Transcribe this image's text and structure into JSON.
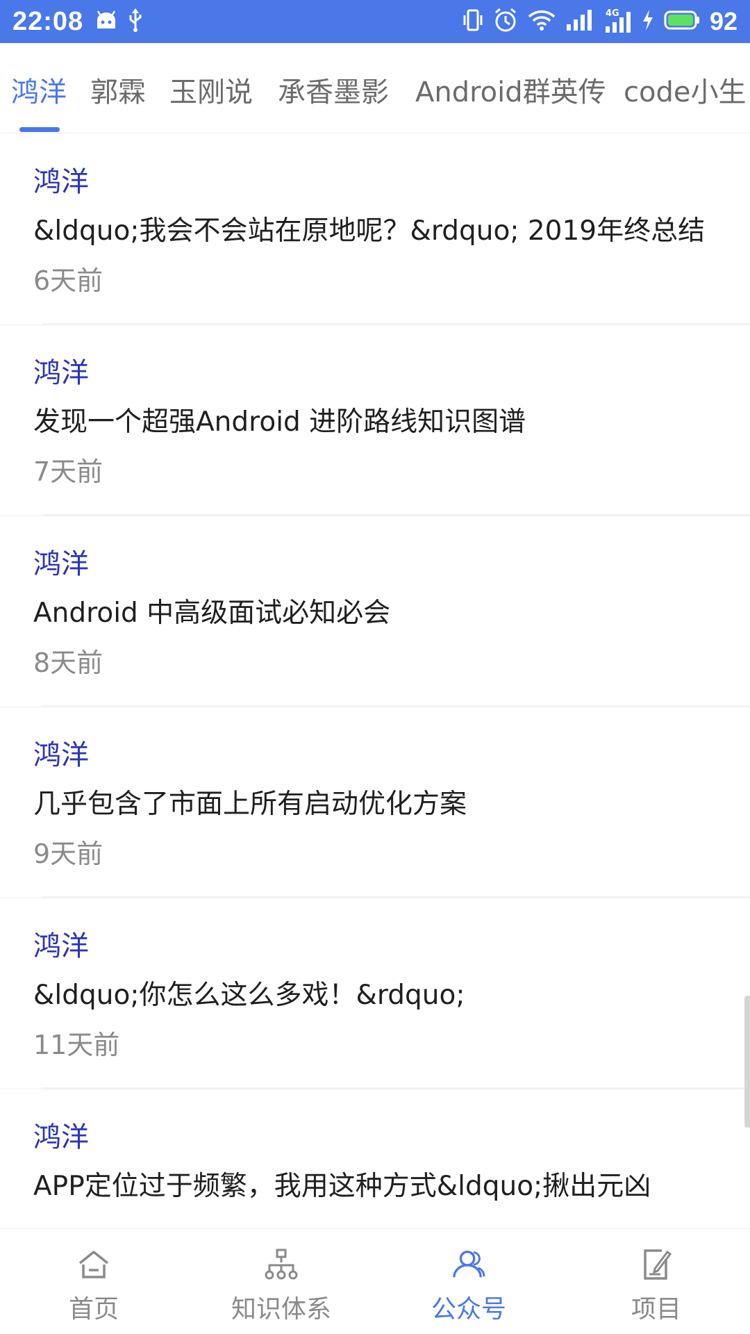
{
  "status_bar": {
    "time": "22:08",
    "network": "4G",
    "battery": "92",
    "colors": {
      "background": "#4a78e8",
      "foreground": "#ffffff"
    }
  },
  "tabs": [
    {
      "label": "鸿洋",
      "active": true
    },
    {
      "label": "郭霖",
      "active": false
    },
    {
      "label": "玉刚说",
      "active": false
    },
    {
      "label": "承香墨影",
      "active": false
    },
    {
      "label": "Android群英传",
      "active": false
    },
    {
      "label": "code小生",
      "active": false
    }
  ],
  "articles": [
    {
      "author": "鸿洋",
      "title": "&ldquo;我会不会站在原地呢？&rdquo; 2019年终总结",
      "time": "6天前"
    },
    {
      "author": "鸿洋",
      "title": "发现一个超强Android 进阶路线知识图谱",
      "time": "7天前"
    },
    {
      "author": "鸿洋",
      "title": "Android 中高级面试必知必会",
      "time": "8天前"
    },
    {
      "author": "鸿洋",
      "title": "几乎包含了市面上所有启动优化方案",
      "time": "9天前"
    },
    {
      "author": "鸿洋",
      "title": "&ldquo;你怎么这么多戏！&rdquo;",
      "time": "11天前"
    },
    {
      "author": "鸿洋",
      "title": "APP定位过于频繁，我用这种方式&ldquo;揪出元凶",
      "time": ""
    }
  ],
  "bottom_nav": [
    {
      "label": "首页",
      "icon": "home-icon",
      "active": false
    },
    {
      "label": "知识体系",
      "icon": "tree-icon",
      "active": false
    },
    {
      "label": "公众号",
      "icon": "people-icon",
      "active": true
    },
    {
      "label": "项目",
      "icon": "project-icon",
      "active": false
    }
  ],
  "colors": {
    "accent": "#4a78e8",
    "author": "#2b34b8",
    "title": "#1f1f1f",
    "secondary": "#8a8a8a"
  }
}
